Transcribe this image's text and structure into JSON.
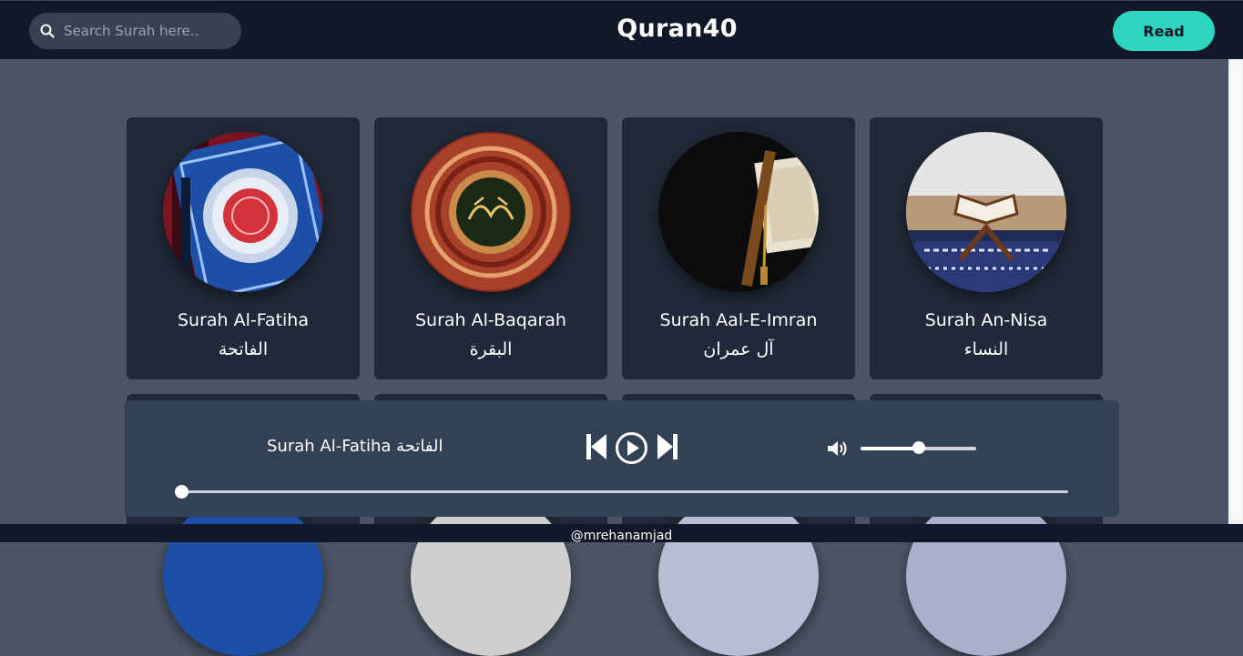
{
  "header": {
    "search_placeholder": "Search Surah here..",
    "brand": "Quran40",
    "read_label": "Read"
  },
  "surahs": [
    {
      "name": "Surah Al-Fatiha",
      "arabic": "الفاتحة"
    },
    {
      "name": "Surah Al-Baqarah",
      "arabic": "البقرة"
    },
    {
      "name": "Surah Aal-E-Imran",
      "arabic": "آل عمران"
    },
    {
      "name": "Surah An-Nisa",
      "arabic": "النساء"
    }
  ],
  "player": {
    "now_playing": "Surah Al-Fatiha الفاتحة",
    "volume": 0.5,
    "progress": 0.0
  },
  "footer": {
    "credit": "@mrehanamjad"
  },
  "colors": {
    "accent": "#2dd4bf",
    "header_bg": "#111827",
    "page_bg": "#4b5565",
    "card_bg": "#1f2937",
    "player_bg": "#334155"
  },
  "icons": [
    "search-icon",
    "previous-icon",
    "play-icon",
    "next-icon",
    "volume-icon"
  ]
}
